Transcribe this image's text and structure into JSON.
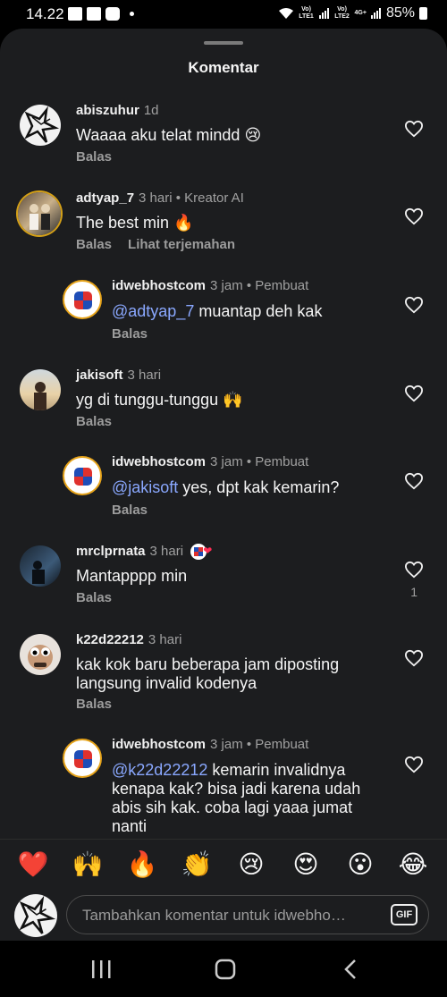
{
  "status_bar": {
    "time": "14.22",
    "sim1_label": "Vo) LTE1",
    "sim2_label": "Vo) LTE2",
    "net_type": "4G+",
    "battery": "85%"
  },
  "sheet": {
    "title": "Komentar"
  },
  "comments": [
    {
      "user": "abiszuhur",
      "meta": "1d",
      "text": "Waaaa aku telat mindd 😢",
      "reply": "Balas"
    },
    {
      "user": "adtyap_7",
      "meta": "3 hari • Kreator AI",
      "text": "The best min 🔥",
      "reply": "Balas",
      "translate": "Lihat terjemahan"
    },
    {
      "user": "idwebhostcom",
      "meta": "3 jam • Pembuat",
      "mention": "@adtyap_7",
      "text": " muantap deh kak",
      "reply": "Balas"
    },
    {
      "user": "jakisoft",
      "meta": "3 hari",
      "text": "yg di tunggu-tunggu 🙌",
      "reply": "Balas"
    },
    {
      "user": "idwebhostcom",
      "meta": "3 jam • Pembuat",
      "mention": "@jakisoft",
      "text": " yes, dpt kak kemarin?",
      "reply": "Balas"
    },
    {
      "user": "mrclprnata",
      "meta": "3 hari",
      "text": "Mantapppp min",
      "reply": "Balas",
      "likes": "1"
    },
    {
      "user": "k22d22212",
      "meta": "3 hari",
      "text": "kak kok baru beberapa jam diposting langsung invalid kodenya",
      "reply": "Balas"
    },
    {
      "user": "idwebhostcom",
      "meta": "3 jam • Pembuat",
      "mention": "@k22d22212",
      "text": " kemarin invalidnya kenapa kak? bisa jadi karena udah abis sih kak. coba lagi yaaa jumat nanti"
    }
  ],
  "reactions": [
    "❤️",
    "🙌",
    "🔥",
    "👏",
    "😢",
    "😍",
    "😮",
    "😂"
  ],
  "composer": {
    "placeholder": "Tambahkan komentar untuk idwebho…",
    "gif_label": "GIF"
  },
  "icons": [
    "heart-icon",
    "gif-icon",
    "recents-icon",
    "home-icon",
    "back-icon"
  ]
}
